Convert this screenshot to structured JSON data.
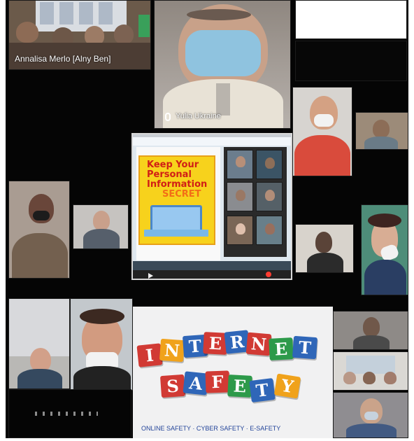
{
  "participants": {
    "top_left_name": "Annalisa Merlo [Alny Ben]",
    "top_center_name": "Yulia Ukraine"
  },
  "shared_screen": {
    "book_title_line1": "Keep Your",
    "book_title_line2": "Personal",
    "book_title_line3": "Information",
    "book_title_line4": "SECRET"
  },
  "banner": {
    "letters_row1": [
      "I",
      "N",
      "T",
      "E",
      "R",
      "N",
      "E",
      "T"
    ],
    "letters_row2": [
      "S",
      "A",
      "F",
      "E",
      "T",
      "Y"
    ],
    "caption": "ONLINE SAFETY · CYBER SAFETY · E-SAFETY"
  },
  "colors": {
    "block_red": "#d13a34",
    "block_blue": "#2f66b8",
    "block_orange": "#f0a21b",
    "block_green": "#2d9a4a",
    "book_yellow": "#f7d21c"
  }
}
